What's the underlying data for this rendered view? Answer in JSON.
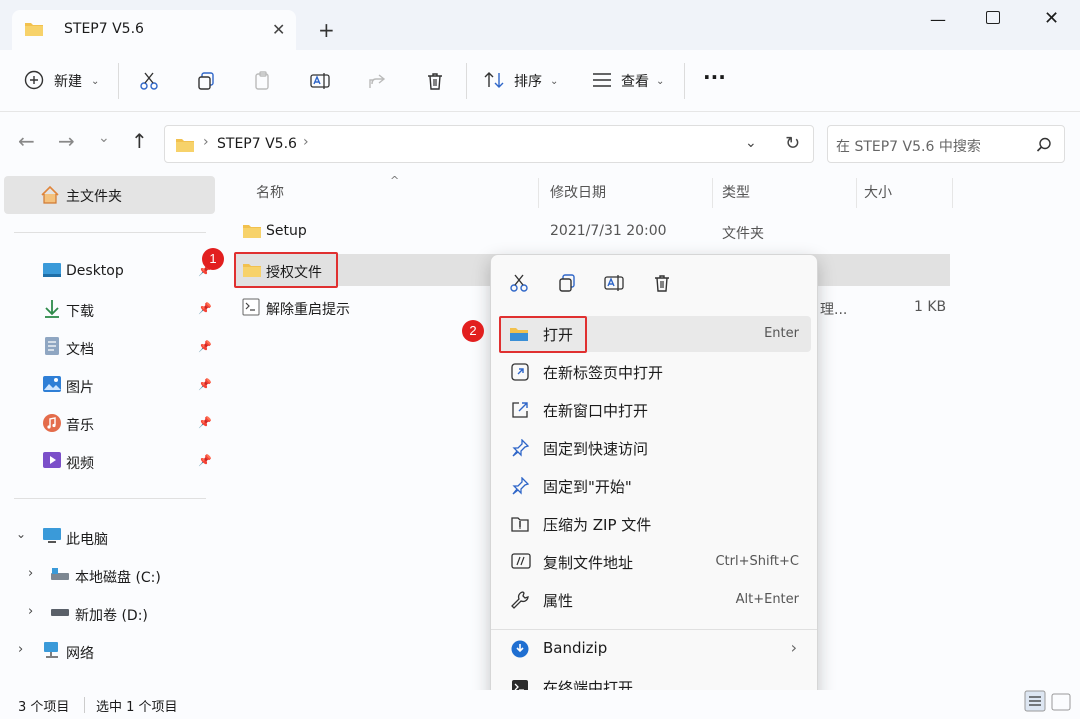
{
  "window": {
    "tab_title": "STEP7 V5.6",
    "close_glyph": "✕",
    "new_tab_glyph": "+",
    "minimize_glyph": "—",
    "close_window_glyph": "✕"
  },
  "toolbar": {
    "new_label": "新建",
    "sort_label": "排序",
    "view_label": "查看",
    "more_label": "···"
  },
  "address": {
    "path_segment": "STEP7 V5.6",
    "separator": "›",
    "search_placeholder": "在 STEP7 V5.6 中搜索"
  },
  "sidebar": {
    "home": "主文件夹",
    "quick": [
      {
        "label": "Desktop",
        "icon": "desktop-icon"
      },
      {
        "label": "下载",
        "icon": "download-icon"
      },
      {
        "label": "文档",
        "icon": "document-icon"
      },
      {
        "label": "图片",
        "icon": "pictures-icon"
      },
      {
        "label": "音乐",
        "icon": "music-icon"
      },
      {
        "label": "视频",
        "icon": "video-icon"
      }
    ],
    "this_pc": "此电脑",
    "drives": [
      "本地磁盘 (C:)",
      "新加卷 (D:)"
    ],
    "network": "网络"
  },
  "columns": {
    "name": "名称",
    "date": "修改日期",
    "type": "类型",
    "size": "大小"
  },
  "files": [
    {
      "name": "Setup",
      "date": "2021/7/31 20:00",
      "type": "文件夹",
      "size": ""
    },
    {
      "name": "授权文件",
      "date": "",
      "type": "",
      "size": ""
    },
    {
      "name": "解除重启提示",
      "date": "",
      "type": "理...",
      "size": "1 KB"
    }
  ],
  "badges": [
    "1",
    "2"
  ],
  "context_menu": {
    "items": [
      {
        "label": "打开",
        "shortcut": "Enter",
        "icon": "folder-open-icon"
      },
      {
        "label": "在新标签页中打开",
        "shortcut": "",
        "icon": "open-new-tab-icon"
      },
      {
        "label": "在新窗口中打开",
        "shortcut": "",
        "icon": "open-new-window-icon"
      },
      {
        "label": "固定到快速访问",
        "shortcut": "",
        "icon": "pin-icon"
      },
      {
        "label": "固定到\"开始\"",
        "shortcut": "",
        "icon": "pin-start-icon"
      },
      {
        "label": "压缩为 ZIP 文件",
        "shortcut": "",
        "icon": "zip-icon"
      },
      {
        "label": "复制文件地址",
        "shortcut": "Ctrl+Shift+C",
        "icon": "copy-path-icon"
      },
      {
        "label": "属性",
        "shortcut": "Alt+Enter",
        "icon": "wrench-icon"
      }
    ],
    "bandizip": "Bandizip",
    "terminal": "在终端中打开"
  },
  "status": {
    "count": "3 个项目",
    "selected": "选中 1 个项目"
  },
  "colors": {
    "accent": "#2f66c8",
    "folder": "#f2c14e",
    "highlight_border": "#e03030"
  }
}
